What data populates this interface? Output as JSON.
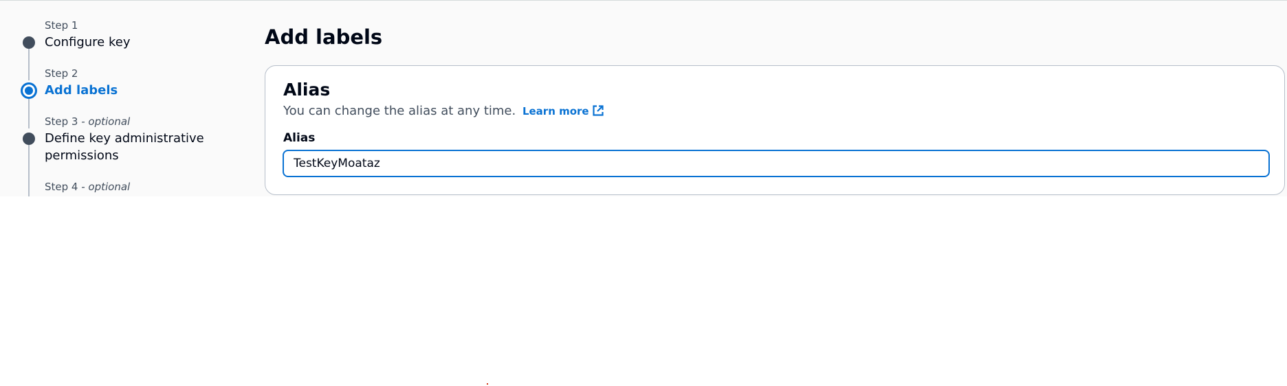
{
  "wizard": {
    "steps": [
      {
        "number": "Step 1",
        "optional": "",
        "title": "Configure key",
        "state": "complete"
      },
      {
        "number": "Step 2",
        "optional": "",
        "title": "Add labels",
        "state": "active"
      },
      {
        "number": "Step 3",
        "optional": " - optional",
        "title": "Define key administrative permissions",
        "state": "pending"
      },
      {
        "number": "Step 4",
        "optional": " - optional",
        "title": "",
        "state": "pending"
      }
    ]
  },
  "page": {
    "title": "Add labels"
  },
  "alias_section": {
    "title": "Alias",
    "description": "You can change the alias at any time.",
    "learn_more": "Learn more",
    "field_label": "Alias",
    "input_value": "TestKeyMoataz"
  },
  "colors": {
    "accent": "#0972d3",
    "text": "#000716",
    "muted": "#414d5c",
    "border": "#b6bec9",
    "background": "#fafafa"
  },
  "icons": {
    "learn_more": "external-link-icon"
  }
}
